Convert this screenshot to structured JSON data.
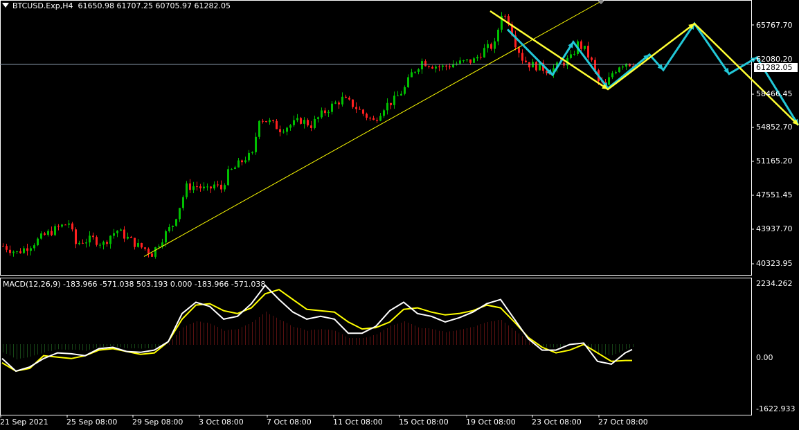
{
  "header": {
    "symbol": "BTCUSD.Exp,H4",
    "ohlc": "61650.98 61707.25 60705.97 61282.05"
  },
  "macd": {
    "label": "MACD(12,26,9) -183.966 -571.038 503.193 0.000 -183.966 -571.038"
  },
  "current_price": "61282.05",
  "price_axis": [
    "65767.70",
    "62080.20",
    "58466.45",
    "54852.70",
    "51165.20",
    "47551.45",
    "43937.70",
    "40323.95"
  ],
  "macd_axis": [
    "2234.262",
    "0.00",
    "-1622.933"
  ],
  "time_axis": [
    "21 Sep 2021",
    "25 Sep 08:00",
    "29 Sep 08:00",
    "3 Oct 08:00",
    "7 Oct 08:00",
    "11 Oct 08:00",
    "15 Oct 08:00",
    "19 Oct 08:00",
    "23 Oct 08:00",
    "27 Oct 08:00"
  ],
  "colors": {
    "background": "#000000",
    "bull": "#00c000",
    "bear": "#ff2020",
    "trendline": "#ffff00",
    "projection_yellow": "#ffff33",
    "projection_cyan": "#22c8d8",
    "hist_pos": "#b22222",
    "hist_neg": "#2e8b2e",
    "macd_line": "#ffffff",
    "signal_line": "#ffff00",
    "grid_border": "#ffffff"
  },
  "chart_data": {
    "type": "candlestick",
    "ylim": [
      39500,
      67800
    ],
    "macd_ylim": [
      -2500,
      2350
    ],
    "close_path": [
      [
        0,
        42500
      ],
      [
        4,
        41800
      ],
      [
        8,
        42600
      ],
      [
        12,
        43600
      ],
      [
        16,
        44400
      ],
      [
        19,
        44900
      ],
      [
        21,
        42700
      ],
      [
        23,
        43000
      ],
      [
        26,
        43200
      ],
      [
        29,
        42700
      ],
      [
        31,
        43600
      ],
      [
        33,
        44100
      ],
      [
        36,
        43300
      ],
      [
        39,
        42500
      ],
      [
        41,
        42200
      ],
      [
        43,
        41700
      ],
      [
        45,
        42800
      ],
      [
        47,
        43800
      ],
      [
        49,
        44700
      ],
      [
        51,
        46600
      ],
      [
        53,
        48600
      ],
      [
        56,
        48700
      ],
      [
        59,
        48200
      ],
      [
        61,
        48800
      ],
      [
        63,
        48400
      ],
      [
        65,
        50000
      ],
      [
        67,
        50600
      ],
      [
        70,
        51600
      ],
      [
        72,
        51900
      ],
      [
        74,
        55800
      ],
      [
        77,
        55300
      ],
      [
        80,
        54600
      ],
      [
        83,
        55000
      ],
      [
        86,
        55500
      ],
      [
        89,
        55000
      ],
      [
        92,
        56100
      ],
      [
        95,
        57000
      ],
      [
        98,
        57700
      ],
      [
        101,
        57100
      ],
      [
        104,
        56200
      ],
      [
        107,
        55400
      ],
      [
        110,
        56900
      ],
      [
        113,
        57600
      ],
      [
        116,
        58800
      ],
      [
        118,
        60300
      ],
      [
        121,
        61600
      ],
      [
        124,
        61200
      ],
      [
        127,
        61000
      ],
      [
        130,
        61300
      ],
      [
        133,
        61500
      ],
      [
        136,
        61700
      ],
      [
        139,
        62800
      ],
      [
        142,
        63300
      ],
      [
        144,
        66600
      ],
      [
        146,
        65800
      ],
      [
        148,
        63500
      ],
      [
        150,
        61900
      ],
      [
        152,
        61300
      ],
      [
        155,
        61000
      ],
      [
        158,
        60600
      ],
      [
        161,
        61300
      ],
      [
        164,
        61900
      ],
      [
        166,
        63400
      ],
      [
        168,
        62800
      ],
      [
        170,
        61500
      ],
      [
        172,
        59500
      ],
      [
        174,
        59000
      ],
      [
        176,
        60400
      ],
      [
        178,
        61200
      ],
      [
        180,
        61500
      ],
      [
        182,
        61282
      ]
    ],
    "macd": [
      [
        0,
        -500
      ],
      [
        4,
        -950
      ],
      [
        8,
        -800
      ],
      [
        12,
        -500
      ],
      [
        16,
        -300
      ],
      [
        20,
        -330
      ],
      [
        24,
        -400
      ],
      [
        28,
        -150
      ],
      [
        32,
        -100
      ],
      [
        36,
        -250
      ],
      [
        40,
        -280
      ],
      [
        44,
        -200
      ],
      [
        48,
        100
      ],
      [
        52,
        1100
      ],
      [
        56,
        1500
      ],
      [
        60,
        1350
      ],
      [
        64,
        900
      ],
      [
        68,
        1000
      ],
      [
        72,
        1450
      ],
      [
        76,
        2100
      ],
      [
        80,
        1600
      ],
      [
        84,
        1150
      ],
      [
        88,
        900
      ],
      [
        92,
        1000
      ],
      [
        96,
        900
      ],
      [
        100,
        400
      ],
      [
        104,
        400
      ],
      [
        108,
        650
      ],
      [
        112,
        1200
      ],
      [
        116,
        1500
      ],
      [
        120,
        1100
      ],
      [
        124,
        1000
      ],
      [
        128,
        800
      ],
      [
        132,
        950
      ],
      [
        136,
        1150
      ],
      [
        140,
        1450
      ],
      [
        144,
        1600
      ],
      [
        148,
        900
      ],
      [
        152,
        200
      ],
      [
        156,
        -200
      ],
      [
        160,
        -200
      ],
      [
        164,
        0
      ],
      [
        168,
        50
      ],
      [
        172,
        -600
      ],
      [
        176,
        -700
      ],
      [
        180,
        -300
      ],
      [
        182,
        -180
      ]
    ],
    "signal": [
      [
        0,
        -650
      ],
      [
        4,
        -950
      ],
      [
        8,
        -850
      ],
      [
        12,
        -400
      ],
      [
        16,
        -450
      ],
      [
        20,
        -500
      ],
      [
        24,
        -400
      ],
      [
        28,
        -200
      ],
      [
        32,
        -150
      ],
      [
        36,
        -250
      ],
      [
        40,
        -350
      ],
      [
        44,
        -300
      ],
      [
        48,
        100
      ],
      [
        52,
        900
      ],
      [
        56,
        1400
      ],
      [
        60,
        1450
      ],
      [
        64,
        1200
      ],
      [
        68,
        1100
      ],
      [
        72,
        1300
      ],
      [
        76,
        1800
      ],
      [
        80,
        1950
      ],
      [
        84,
        1600
      ],
      [
        88,
        1250
      ],
      [
        92,
        1200
      ],
      [
        96,
        1150
      ],
      [
        100,
        800
      ],
      [
        104,
        550
      ],
      [
        108,
        600
      ],
      [
        112,
        800
      ],
      [
        116,
        1250
      ],
      [
        120,
        1300
      ],
      [
        124,
        1150
      ],
      [
        128,
        1050
      ],
      [
        132,
        1100
      ],
      [
        136,
        1200
      ],
      [
        140,
        1400
      ],
      [
        144,
        1300
      ],
      [
        148,
        800
      ],
      [
        152,
        250
      ],
      [
        156,
        -100
      ],
      [
        160,
        -300
      ],
      [
        164,
        -200
      ],
      [
        168,
        0
      ],
      [
        172,
        -300
      ],
      [
        176,
        -600
      ],
      [
        180,
        -570
      ],
      [
        182,
        -571
      ]
    ],
    "trendline": [
      [
        41,
        41400
      ],
      [
        173,
        67800
      ]
    ],
    "projection_yellow": [
      [
        141,
        66800
      ],
      [
        175,
        58700
      ],
      [
        200,
        65500
      ],
      [
        230,
        55000
      ]
    ],
    "projection_cyan": [
      [
        146,
        64900
      ],
      [
        159,
        60200
      ],
      [
        165,
        63600
      ],
      [
        175,
        58800
      ],
      [
        187,
        62300
      ],
      [
        191,
        60700
      ],
      [
        200,
        65500
      ],
      [
        210,
        60300
      ],
      [
        218,
        62000
      ],
      [
        230,
        55000
      ]
    ]
  }
}
